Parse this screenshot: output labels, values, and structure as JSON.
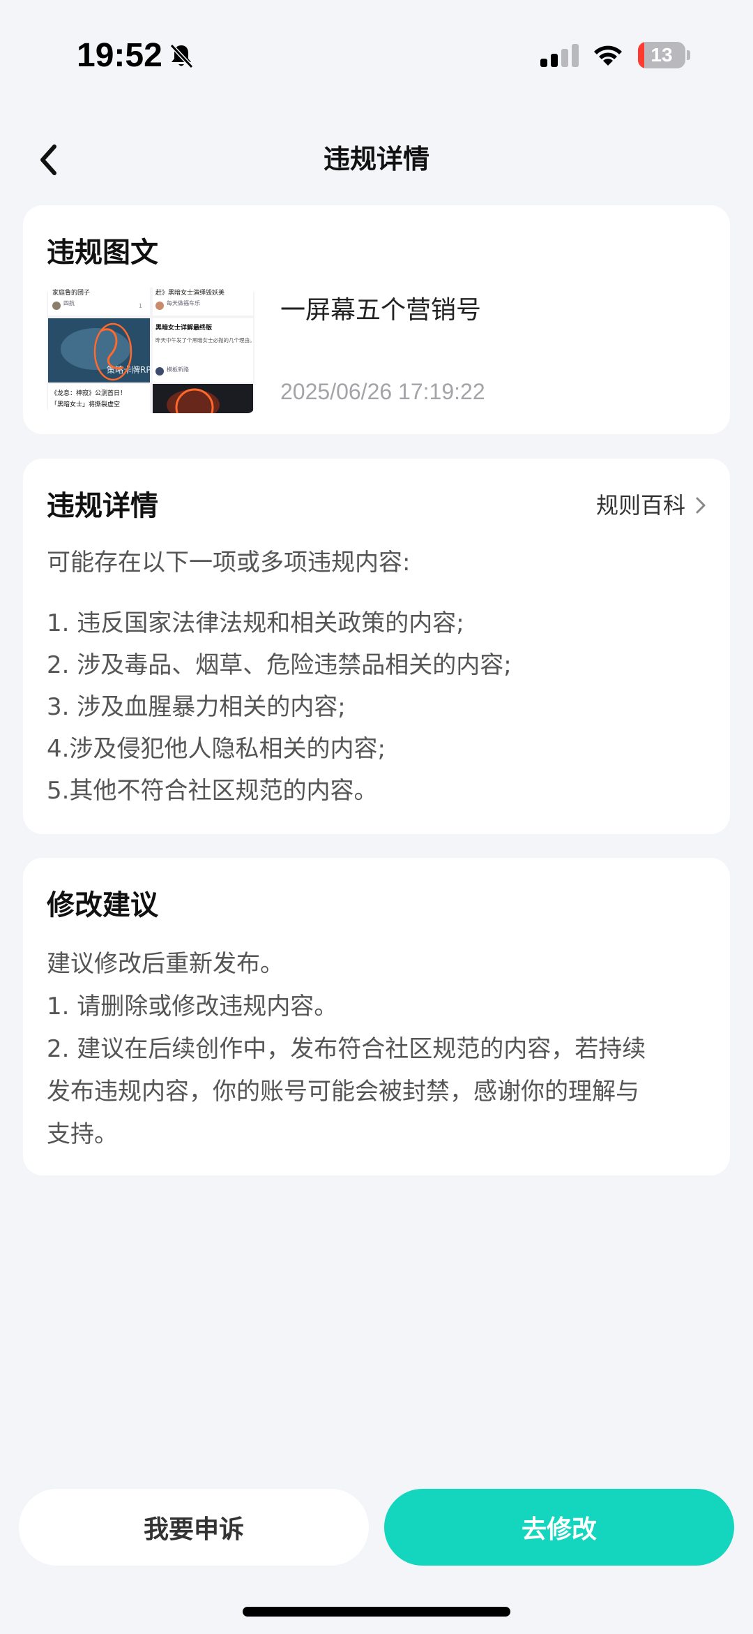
{
  "status_bar": {
    "time": "19:52",
    "battery_level": "13",
    "battery_fraction": 0.13,
    "battery_color": "#ff3b30",
    "icons": [
      "bell-muted-icon",
      "signal-icon",
      "wifi-icon",
      "battery-icon"
    ]
  },
  "nav": {
    "title": "违规详情",
    "back_icon": "chevron-left-icon"
  },
  "post_card": {
    "heading": "违规图文",
    "post_title": "一屏幕五个营销号",
    "post_date": "2025/06/26 17:19:22",
    "thumbnail": {
      "caption_top_left": "家庭鲁的团子",
      "caption_top_right": "赶》黑暗女士演绎毁妖美",
      "author_left": "四航",
      "author_right": "每天做福车乐",
      "right_post_title": "黑暗女士详解最终版",
      "right_post_body": "昨天中午发了个黑暗女士必抛的几个理由。可惜内容量消息…",
      "right_post_author": "模板新路",
      "watermark": "策略卡牌RP",
      "bottom_left_1": "《龙息：神寂》公测首日！",
      "bottom_left_2": "「黑暗女士」将撕裂虚空",
      "like_count": "1"
    }
  },
  "violation_card": {
    "heading": "违规详情",
    "rules_link": "规则百科",
    "intro": "可能存在以下一项或多项违规内容:",
    "items": [
      "1. 违反国家法律法规和相关政策的内容;",
      "2. 涉及毒品、烟草、危险违禁品相关的内容;",
      "3. 涉及血腥暴力相关的内容;",
      "4.涉及侵犯他人隐私相关的内容;",
      "5.其他不符合社区规范的内容。"
    ]
  },
  "suggestion_card": {
    "heading": "修改建议",
    "lines": [
      "建议修改后重新发布。",
      "1. 请删除或修改违规内容。",
      "2. 建议在后续创作中，发布符合社区规范的内容，若持续",
      "发布违规内容，你的账号可能会被封禁，感谢你的理解与",
      "支持。"
    ]
  },
  "buttons": {
    "appeal": "我要申诉",
    "edit": "去修改",
    "accent_color": "#14d6bf"
  }
}
